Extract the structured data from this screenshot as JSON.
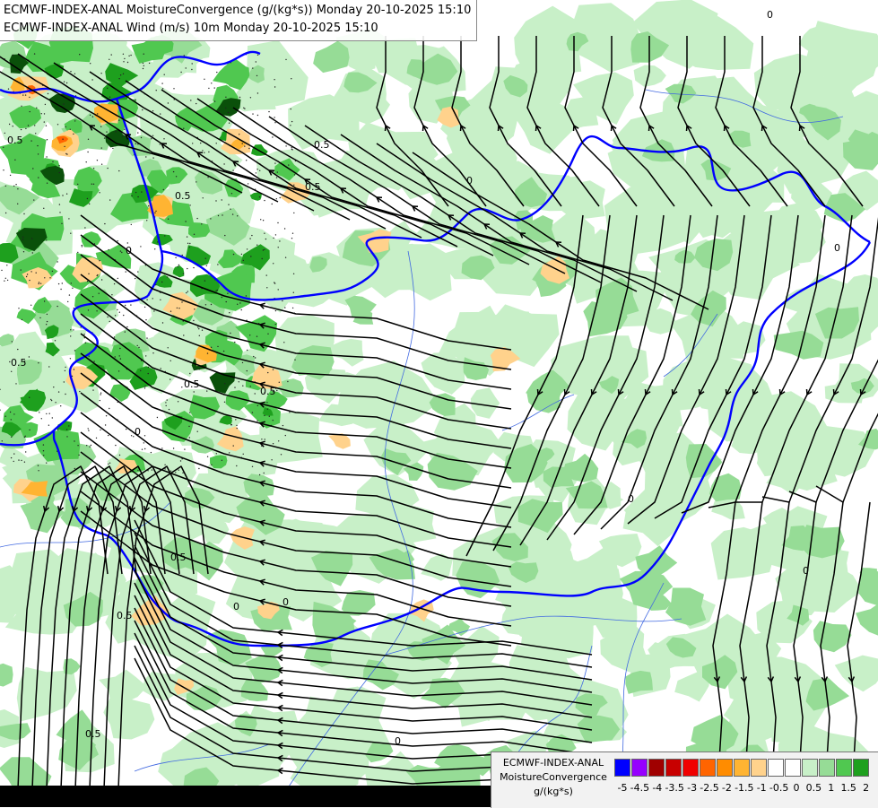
{
  "header": {
    "line1": "ECMWF-INDEX-ANAL MoistureConvergence (g/(kg*s)) Monday 20-10-2025 15:10",
    "line2": "ECMWF-INDEX-ANAL Wind (m/s) 10m Monday 20-10-2025 15:10"
  },
  "legend": {
    "model": "ECMWF-INDEX-ANAL",
    "parameter": "MoistureConvergence",
    "unit": "g/(kg*s)",
    "colors": [
      "#0000ff",
      "#9600ff",
      "#a00000",
      "#c80000",
      "#f00000",
      "#ff6400",
      "#ff8c00",
      "#ffb432",
      "#ffd28c",
      "#ffffff",
      "#ffffff",
      "#c8f0c8",
      "#96dc96",
      "#50c850",
      "#1ea01e"
    ],
    "ticks": [
      "-5",
      "-4.5",
      "-4",
      "-3.5",
      "-3",
      "-2.5",
      "-2",
      "-1.5",
      "-1",
      "-0.5",
      "0",
      "0.5",
      "1",
      "1.5",
      "2"
    ]
  },
  "map": {
    "field_colors": {
      "background": "#ffffff",
      "light_green": "#c8f0c8",
      "mid_green": "#96dc96",
      "green": "#50c850",
      "dark_green": "#1ea01e",
      "darkest_green": "#0a500a",
      "light_orange": "#ffd28c",
      "orange": "#ffb432",
      "dark_orange": "#ff8c00",
      "red_orange": "#ff6400",
      "border_blue": "#0000ff",
      "river_blue": "#4169e1"
    },
    "contour_labels": [
      "0.5",
      "0.5",
      "0.5",
      "0.5",
      "0.5",
      "0.5",
      "0.5",
      "0.5",
      "0.5",
      "0.5",
      "0",
      "0",
      "0",
      "0",
      "0",
      "0",
      "0",
      "0",
      "0",
      "0"
    ]
  }
}
